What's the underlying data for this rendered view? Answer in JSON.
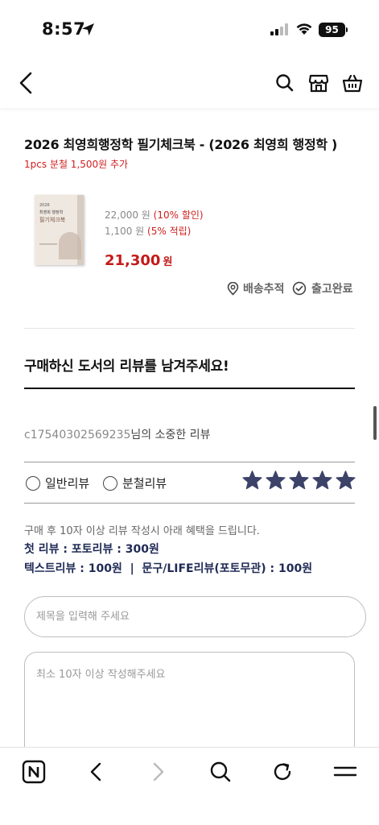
{
  "status_bar": {
    "time": "8:57",
    "battery": "95"
  },
  "header": {
    "back_icon": "chevron-left-icon",
    "search_icon": "search-icon",
    "store_icon": "store-icon",
    "cart_icon": "basket-icon"
  },
  "product": {
    "title": "2026 최영희행정학 필기체크북 - (2026 최영희 행정학 )",
    "promo": "1pcs 분철 1,500원 추가",
    "cover_year": "2026",
    "cover_author": "최영희 행정학",
    "cover_title": "필기체크북",
    "original_price": "22,000 원",
    "discount": "(10% 할인)",
    "point": "1,100 원",
    "point_rate": "(5% 적립)",
    "final_price": "21,300",
    "final_unit": "원",
    "track_label": "배송추적",
    "shipped_label": "출고완료"
  },
  "review": {
    "section_title": "구매하신 도서의 리뷰를 남겨주세요!",
    "reviewer_id": "c17540302569235",
    "reviewer_suffix": "님의 소중한 리뷰",
    "type_options": [
      "일반리뷰",
      "분철리뷰"
    ],
    "rating": 5,
    "rating_max": 5,
    "star_color": "#3c4268",
    "benefit_intro": "구매 후 10자 이상 리뷰 작성시 아래 혜택을 드립니다.",
    "benefit_line1": "첫 리뷰 : 포토리뷰 : 300원",
    "benefit_line2": "텍스트리뷰 : 100원  |  문구/LIFE리뷰(포토무관) : 100원",
    "title_placeholder": "제목을 입력해 주세요",
    "body_placeholder": "최소 10자 이상 작성해주세요"
  },
  "bottom_nav": [
    "naver-n-icon",
    "back-arrow-icon",
    "forward-arrow-icon",
    "search-icon",
    "refresh-icon",
    "menu-icon"
  ],
  "colors": {
    "accent_red": "#d0201f",
    "price_red": "#c41a1a",
    "navy": "#1f2a55"
  }
}
